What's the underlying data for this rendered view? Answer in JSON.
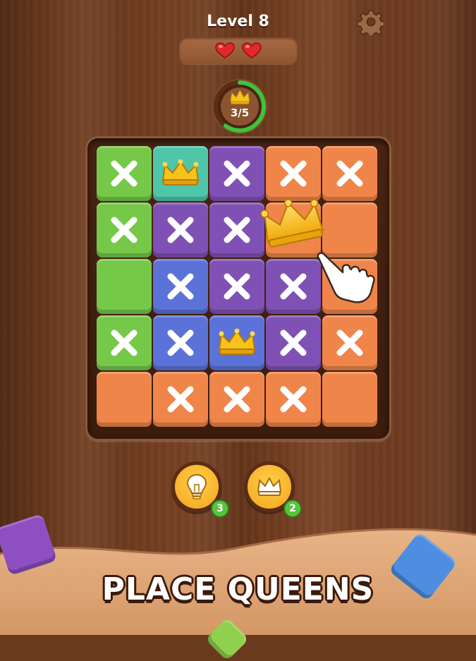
{
  "header": {
    "level_label": "Level 8",
    "lives": 2
  },
  "progress": {
    "label": "3/5",
    "placed": 3,
    "total": 5,
    "fraction": 0.6
  },
  "board": {
    "rows": 5,
    "cols": 5,
    "cells": [
      [
        {
          "color": "green",
          "mark": "x"
        },
        {
          "color": "teal",
          "mark": "crown"
        },
        {
          "color": "purple",
          "mark": "x"
        },
        {
          "color": "orange",
          "mark": "x"
        },
        {
          "color": "orange",
          "mark": "x"
        }
      ],
      [
        {
          "color": "green",
          "mark": "x"
        },
        {
          "color": "purple",
          "mark": "x"
        },
        {
          "color": "purple",
          "mark": "x"
        },
        {
          "color": "orange",
          "mark": "empty"
        },
        {
          "color": "orange",
          "mark": "empty"
        }
      ],
      [
        {
          "color": "green",
          "mark": "empty"
        },
        {
          "color": "blue",
          "mark": "x"
        },
        {
          "color": "purple",
          "mark": "x"
        },
        {
          "color": "purple",
          "mark": "x"
        },
        {
          "color": "orange",
          "mark": "empty"
        }
      ],
      [
        {
          "color": "green",
          "mark": "x"
        },
        {
          "color": "blue",
          "mark": "x"
        },
        {
          "color": "blue",
          "mark": "crown"
        },
        {
          "color": "purple",
          "mark": "x"
        },
        {
          "color": "orange",
          "mark": "x"
        }
      ],
      [
        {
          "color": "orange",
          "mark": "empty"
        },
        {
          "color": "orange",
          "mark": "x"
        },
        {
          "color": "orange",
          "mark": "x"
        },
        {
          "color": "orange",
          "mark": "x"
        },
        {
          "color": "orange",
          "mark": "empty"
        }
      ]
    ],
    "dragging_piece": "crown-icon"
  },
  "powerups": {
    "hint": {
      "icon": "lightbulb-icon",
      "count": "3"
    },
    "queen": {
      "icon": "crown-icon",
      "count": "2"
    }
  },
  "banner": {
    "text": "PLACE QUEENS"
  },
  "colors": {
    "green": "#76c848",
    "teal": "#4fc6a9",
    "purple": "#8051b5",
    "orange": "#f0854a",
    "blue": "#5b73d8",
    "progress_ring": "#3cc43a",
    "heart": "#e0282e",
    "crown": "#f6c21b"
  }
}
